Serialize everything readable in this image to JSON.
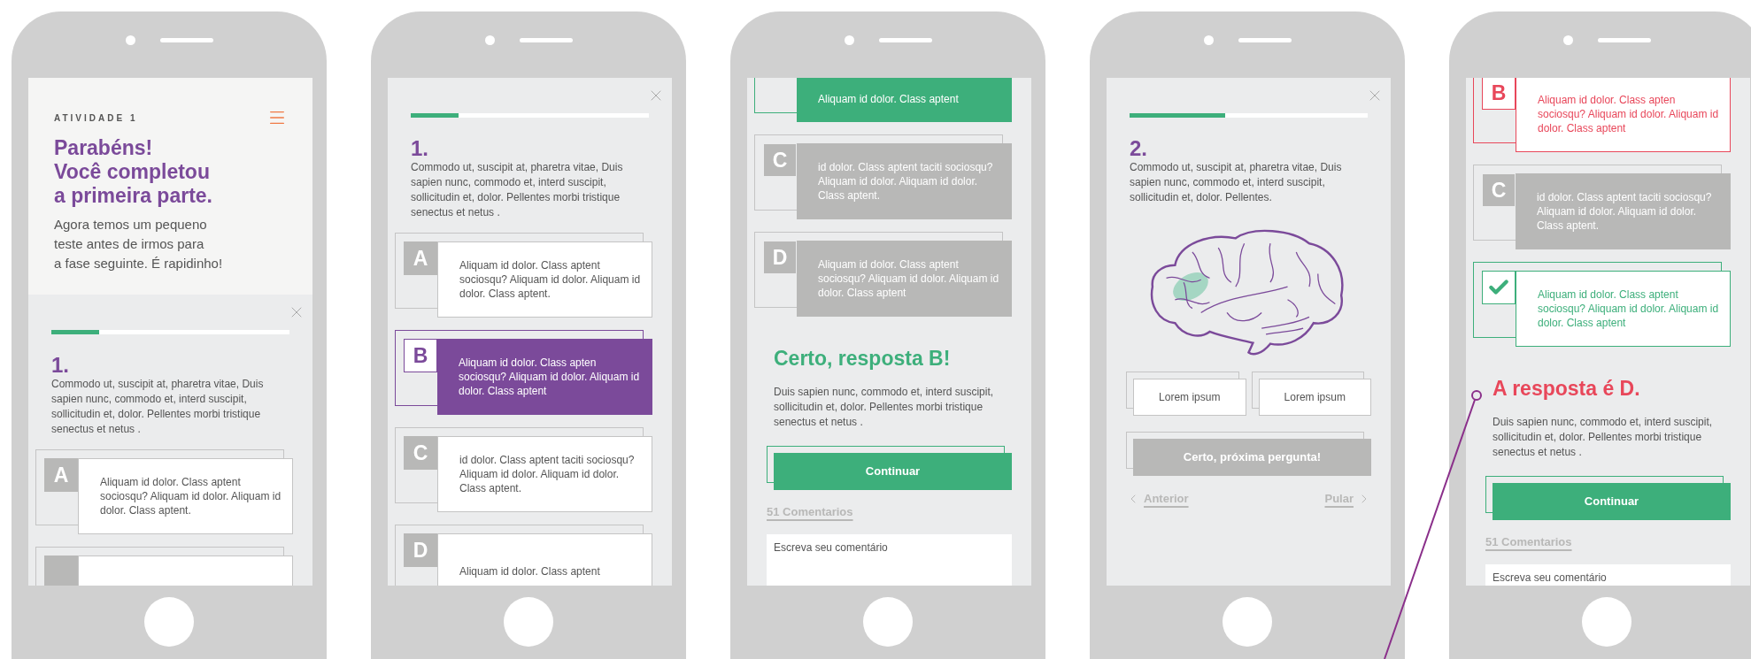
{
  "screens": [
    {
      "scrolled": false,
      "blocks": [
        {
          "kind": "intro",
          "label": "ATIVIDADE 1",
          "title": "Parabéns!\nVocê completou\na primeira parte.",
          "subtitle": "Agora temos um pequeno\nteste antes de irmos para\na fase seguinte. É rapidinho!"
        },
        {
          "kind": "close"
        },
        {
          "kind": "progress",
          "level": 0.2
        },
        {
          "kind": "question",
          "number": "1.",
          "text": "Commodo ut, suscipit at, pharetra vitae, Duis sapien nunc, commodo et, interd suscipit, sollicitudin et, dolor. Pellentes morbi tristique senectus et netus ."
        },
        {
          "kind": "option",
          "letter": "A",
          "text": "Aliquam id dolor. Class aptent sociosqu? Aliquam id dolor. Aliquam id dolor. Class aptent.",
          "selected": false,
          "dimmed": false
        },
        {
          "kind": "option",
          "selected": false,
          "dimmed": false
        }
      ]
    },
    {
      "scrolled": false,
      "blocks": [
        {
          "kind": "close"
        },
        {
          "kind": "progress",
          "level": 0.2
        },
        {
          "kind": "question",
          "number": "1.",
          "text": "Commodo ut, suscipit at, pharetra vitae, Duis sapien nunc, commodo et, interd suscipit, sollicitudin et, dolor. Pellentes morbi tristique senectus et netus ."
        },
        {
          "kind": "option",
          "letter": "A",
          "text": "Aliquam id dolor. Class aptent sociosqu? Aliquam id dolor. Aliquam id dolor. Class aptent.",
          "selected": false,
          "dimmed": false
        },
        {
          "kind": "option",
          "letter": "B",
          "text": "Aliquam id dolor. Class apten sociosqu? Aliquam id dolor. Aliquam id dolor. Class aptent",
          "selected": true,
          "dimmed": false
        },
        {
          "kind": "option",
          "letter": "C",
          "text": "id dolor. Class aptent taciti sociosqu? Aliquam id dolor. Aliquam id dolor. Class aptent.",
          "selected": false,
          "dimmed": false
        },
        {
          "kind": "option",
          "letter": "D",
          "text": "Aliquam id dolor. Class aptent",
          "selected": false,
          "dimmed": false
        }
      ]
    },
    {
      "scrolled": true,
      "blocks": [
        {
          "kind": "option",
          "text": "Aliquam id dolor. Class aptent",
          "selected": true,
          "correct": true,
          "dimmed": false
        },
        {
          "kind": "option",
          "letter": "C",
          "text": "id dolor. Class aptent taciti sociosqu? Aliquam id dolor. Aliquam id dolor. Class aptent.",
          "selected": false,
          "correct": false,
          "dimmed": true
        },
        {
          "kind": "option",
          "letter": "D",
          "text": "Aliquam id dolor. Class aptent sociosqu? Aliquam id dolor. Aliquam id dolor. Class aptent",
          "selected": false,
          "correct": false,
          "dimmed": true
        },
        {
          "kind": "feedback",
          "correct": true,
          "title": "Certo, resposta B!",
          "text": "Duis sapien nunc, commodo et, interd suscipit, sollicitudin et, dolor. Pellentes morbi tristique senectus et netus ."
        },
        {
          "kind": "button",
          "label": "Continuar",
          "disabled": false
        },
        {
          "kind": "comments",
          "label": "51 Comentarios"
        },
        {
          "kind": "comment_field",
          "placeholder": "Escreva seu comentário"
        }
      ]
    },
    {
      "scrolled": false,
      "blocks": [
        {
          "kind": "close"
        },
        {
          "kind": "progress",
          "level": 0.4
        },
        {
          "kind": "question",
          "number": "2.",
          "text": "Commodo ut, suscipit at, pharetra vitae, Duis sapien nunc, commodo et, interd suscipit, sollicitudin et, dolor. Pellentes."
        },
        {
          "kind": "brain"
        },
        {
          "kind": "choices",
          "items": [
            "Lorem ipsum",
            "Lorem ipsum"
          ]
        },
        {
          "kind": "button",
          "label": "Certo, próxima pergunta!",
          "disabled": true
        },
        {
          "kind": "nav",
          "previous": "Anterior",
          "next": "Pular"
        }
      ]
    },
    {
      "scrolled": true,
      "blocks": [
        {
          "kind": "option",
          "letter": "B",
          "text": "Aliquam id dolor. Class apten sociosqu? Aliquam id dolor. Aliquam id dolor. Class aptent",
          "selected": true,
          "correct": false,
          "dimmed": false
        },
        {
          "kind": "option",
          "letter": "C",
          "text": "id dolor. Class aptent taciti sociosqu? Aliquam id dolor. Aliquam id dolor. Class aptent.",
          "selected": false,
          "correct": false,
          "dimmed": true
        },
        {
          "kind": "option",
          "text": "Aliquam id dolor. Class aptent sociosqu? Aliquam id dolor. Aliquam id dolor. Class aptent",
          "selected": false,
          "correct": true,
          "dimmed": false
        },
        {
          "kind": "feedback",
          "correct": false,
          "title": "A resposta é D.",
          "text": "Duis sapien nunc, commodo et, interd suscipit, sollicitudin et, dolor. Pellentes morbi tristique senectus et netus ."
        },
        {
          "kind": "button",
          "label": "Continuar",
          "disabled": false
        },
        {
          "kind": "comments",
          "label": "51 Comentarios"
        },
        {
          "kind": "comment_field",
          "placeholder": "Escreva seu comentário"
        }
      ]
    }
  ]
}
